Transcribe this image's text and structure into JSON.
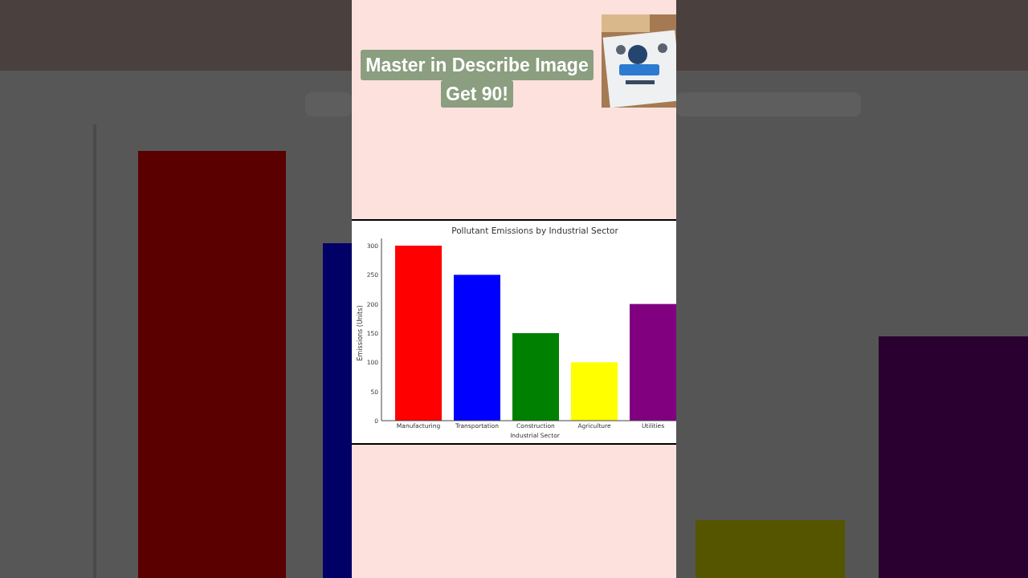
{
  "headline": {
    "lines": [
      "Master in Describe Image",
      "Get 90!"
    ]
  },
  "chart": {
    "chart_data": {
      "type": "bar",
      "title": "Pollutant Emissions by Industrial Sector",
      "xlabel": "Industrial Sector",
      "ylabel": "Emissions (Units)",
      "categories": [
        "Manufacturing",
        "Transportation",
        "Construction",
        "Agriculture",
        "Utilities"
      ],
      "series": [
        {
          "color": "#ff0000",
          "values": [
            300,
            null,
            null,
            null,
            null
          ]
        },
        {
          "color": "#0000ff",
          "values": [
            null,
            250,
            null,
            null,
            null
          ]
        },
        {
          "color": "#008000",
          "values": [
            null,
            null,
            150,
            null,
            null
          ]
        },
        {
          "color": "#ffff00",
          "values": [
            null,
            null,
            null,
            100,
            null
          ]
        },
        {
          "color": "#800080",
          "values": [
            null,
            null,
            null,
            null,
            200
          ]
        }
      ],
      "stacked": true,
      "ylim": [
        0,
        300
      ],
      "yticks": [
        0,
        50,
        100,
        150,
        200,
        250,
        300
      ]
    }
  }
}
